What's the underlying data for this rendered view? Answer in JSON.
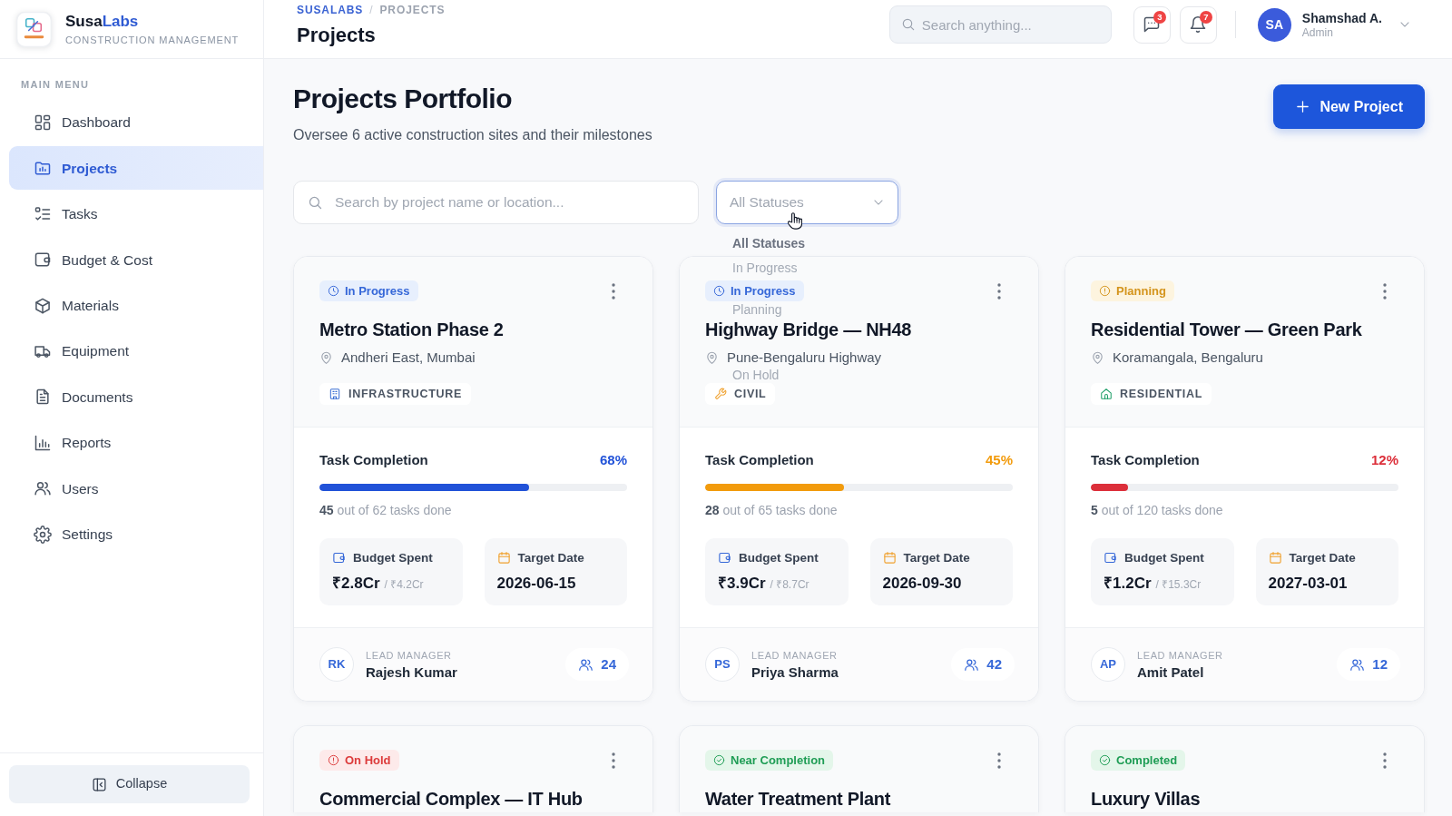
{
  "sidebar": {
    "brand": {
      "name": "Susa",
      "name_accent": "Labs",
      "tagline": "CONSTRUCTION MANAGEMENT"
    },
    "section_label": "MAIN MENU",
    "items": [
      {
        "label": "Dashboard",
        "selected": false
      },
      {
        "label": "Projects",
        "selected": true
      },
      {
        "label": "Tasks",
        "selected": false
      },
      {
        "label": "Budget & Cost",
        "selected": false
      },
      {
        "label": "Materials",
        "selected": false
      },
      {
        "label": "Equipment",
        "selected": false
      },
      {
        "label": "Documents",
        "selected": false
      },
      {
        "label": "Reports",
        "selected": false
      },
      {
        "label": "Users",
        "selected": false
      },
      {
        "label": "Settings",
        "selected": false
      }
    ],
    "collapse_button": "Collapse"
  },
  "topbar": {
    "breadcrumb": [
      {
        "label": "SUSALABS",
        "kind": "link"
      },
      {
        "label": "PROJECTS",
        "kind": "current"
      }
    ],
    "breadcrumb_separator": "/",
    "page_title": "Projects",
    "search": {
      "placeholder": "Search anything..."
    },
    "icon_buttons": [
      {
        "badge": "3"
      },
      {
        "badge": "7"
      }
    ],
    "user": {
      "initials": "SA",
      "name": "Shamshad A.",
      "role": "Admin"
    }
  },
  "main": {
    "heading": "Projects Portfolio",
    "subtitle": "Oversee 6 active construction sites and their milestones",
    "new_button": "New Project",
    "filters": {
      "search": {
        "placeholder": "Search by project name or location..."
      },
      "status_select": {
        "value": "All Statuses",
        "expanded": true,
        "options": [
          {
            "label": "All Statuses",
            "selected": true
          },
          {
            "label": "In Progress",
            "selected": false
          },
          {
            "label": "Planning",
            "selected": false
          },
          {
            "label": "On Hold",
            "selected": false
          }
        ]
      }
    },
    "cards": [
      {
        "status": {
          "label": "In Progress",
          "kind": "in_progress"
        },
        "title": "Metro Station Phase 2",
        "location": "Andheri East, Mumbai",
        "category": {
          "label": "INFRASTRUCTURE",
          "kind": "infrastructure"
        },
        "progress": {
          "label": "Task Completion",
          "reading": "68%",
          "level": 0.68,
          "color": "#2152d8"
        },
        "tasks_done": "**45** out of 62 tasks done",
        "budget": {
          "label": "Budget Spent",
          "spent": "₹2.8Cr",
          "total": "/ ₹4.2Cr"
        },
        "target": {
          "label": "Target Date",
          "date": "2026-06-15"
        },
        "manager": {
          "initials": "RK",
          "label": "LEAD MANAGER",
          "name": "Rajesh Kumar"
        },
        "team_count": "24"
      },
      {
        "status": {
          "label": "In Progress",
          "kind": "in_progress"
        },
        "title": "Highway Bridge — NH48",
        "location": "Pune-Bengaluru Highway",
        "category": {
          "label": "CIVIL",
          "kind": "civil"
        },
        "progress": {
          "label": "Task Completion",
          "reading": "45%",
          "level": 0.45,
          "color": "#f29b0c"
        },
        "tasks_done": "**28** out of 65 tasks done",
        "budget": {
          "label": "Budget Spent",
          "spent": "₹3.9Cr",
          "total": "/ ₹8.7Cr"
        },
        "target": {
          "label": "Target Date",
          "date": "2026-09-30"
        },
        "manager": {
          "initials": "PS",
          "label": "LEAD MANAGER",
          "name": "Priya Sharma"
        },
        "team_count": "42"
      },
      {
        "status": {
          "label": "Planning",
          "kind": "planning"
        },
        "title": "Residential Tower — Green Park",
        "location": "Koramangala, Bengaluru",
        "category": {
          "label": "RESIDENTIAL",
          "kind": "residential"
        },
        "progress": {
          "label": "Task Completion",
          "reading": "12%",
          "level": 0.12,
          "color": "#dc2f3a"
        },
        "tasks_done": "**5** out of 120 tasks done",
        "budget": {
          "label": "Budget Spent",
          "spent": "₹1.2Cr",
          "total": "/ ₹15.3Cr"
        },
        "target": {
          "label": "Target Date",
          "date": "2027-03-01"
        },
        "manager": {
          "initials": "AP",
          "label": "LEAD MANAGER",
          "name": "Amit Patel"
        },
        "team_count": "12"
      },
      {
        "status": {
          "label": "On Hold",
          "kind": "on_hold"
        },
        "title": "Commercial Complex — IT Hub"
      },
      {
        "status": {
          "label": "Near Completion",
          "kind": "near_completion"
        },
        "title": "Water Treatment Plant"
      },
      {
        "status": {
          "label": "Completed",
          "kind": "completed"
        },
        "title": "Luxury Villas"
      }
    ]
  }
}
